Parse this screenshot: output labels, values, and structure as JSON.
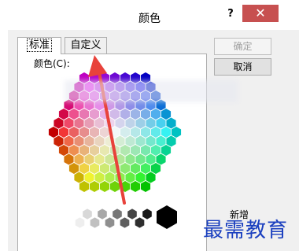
{
  "dialog": {
    "title": "颜色",
    "help_label": "?",
    "close_label": "✕"
  },
  "tabs": [
    {
      "label": "标准"
    },
    {
      "label": "自定义"
    }
  ],
  "colors_label": "颜色(C):",
  "buttons": {
    "ok_label": "确定",
    "cancel_label": "取消"
  },
  "new_label": "新增",
  "watermark": "最需教育",
  "icons": {
    "arrow": "red-pointer-arrow-icon"
  },
  "colors": {
    "accent_close": "#c75050",
    "arrow": "#e8423b",
    "watermark": "#1a3fbf"
  }
}
